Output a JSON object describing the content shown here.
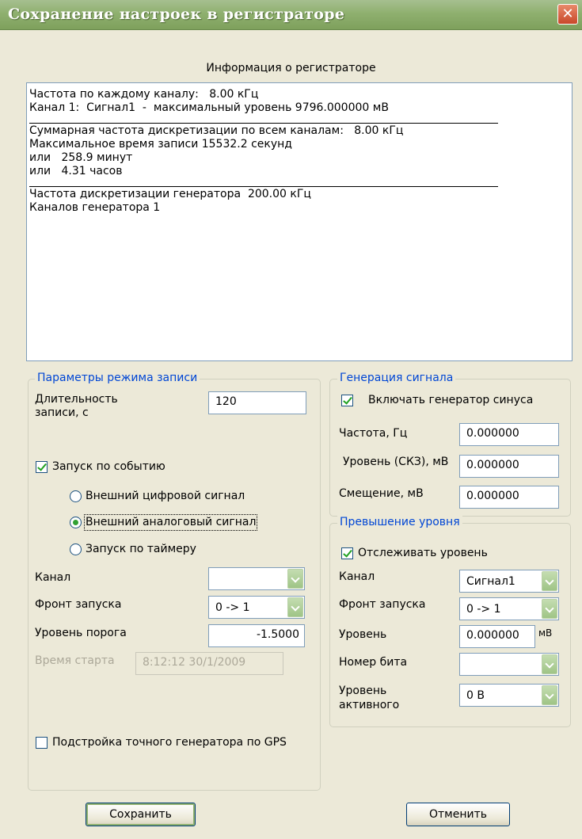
{
  "window": {
    "title": "Сохранение настроек в регистраторе",
    "close_glyph": "✕"
  },
  "info": {
    "heading": "Информация о регистраторе",
    "block1": [
      "Частота по каждому каналу:   8.00 кГц",
      "Канал 1:  Сигнал1  -  максимальный уровень 9796.000000 мВ"
    ],
    "block2": [
      "Суммарная частота дискретизации по всем каналам:   8.00 кГц",
      "Максимальное время записи 15532.2 секунд",
      "или   258.9 минут",
      "или   4.31 часов"
    ],
    "block3": [
      "Частота дискретизации генератора  200.00 кГц",
      "Каналов генератора 1"
    ]
  },
  "record": {
    "legend": "Параметры режима записи",
    "duration_label_1": "Длительность",
    "duration_label_2": "записи, с",
    "duration_value": "120",
    "trigger_label": "Запуск по событию",
    "trigger_checked": true,
    "radio_digital": "Внешний цифровой сигнал",
    "radio_analog": "Внешний аналоговый сигнал",
    "radio_timer": "Запуск по таймеру",
    "selected_radio": "analog",
    "channel_label": "Канал",
    "channel_value": "",
    "front_label": "Фронт запуска",
    "front_value": "0 -> 1",
    "threshold_label": "Уровень порога",
    "threshold_value": "-1.5000",
    "start_time_label": "Время старта",
    "start_time_value": "8:12:12 30/1/2009",
    "gps_label": "Подстройка точного генератора по GPS",
    "gps_checked": false
  },
  "generator": {
    "legend": "Генерация сигнала",
    "enable_label": "Включать генератор синуса",
    "enable_checked": true,
    "freq_label": "Частота, Гц",
    "freq_value": "0.000000",
    "level_label": "Уровень (СКЗ), мВ",
    "level_value": "0.000000",
    "offset_label": "Смещение, мВ",
    "offset_value": "0.000000"
  },
  "exceed": {
    "legend": "Превышение уровня",
    "track_label": "Отслеживать уровень",
    "track_checked": true,
    "channel_label": "Канал",
    "channel_value": "Сигнал1",
    "front_label": "Фронт запуска",
    "front_value": "0 -> 1",
    "level_label": "Уровень",
    "level_value": "0.000000",
    "level_unit": "мВ",
    "bit_label": "Номер бита",
    "bit_value": "",
    "active_label_1": "Уровень",
    "active_label_2": "активного",
    "active_value": "0 В"
  },
  "buttons": {
    "save": "Сохранить",
    "cancel": "Отменить"
  },
  "colors": {
    "titlebar": "#8fb06f",
    "group_legend": "#0046d5",
    "checkmark": "#21a121"
  }
}
